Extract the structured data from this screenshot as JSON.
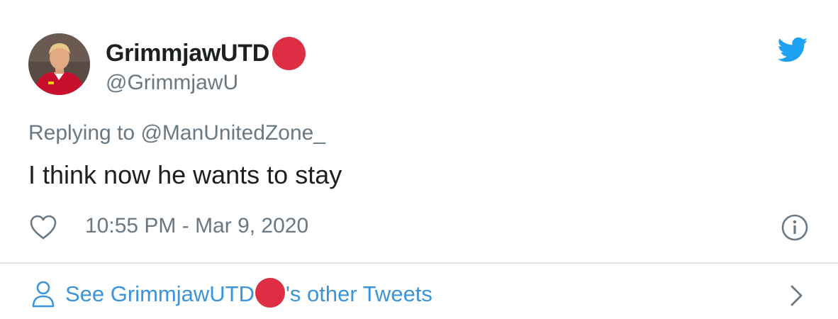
{
  "author": {
    "display_name": "GrimmjawUTD",
    "handle": "@GrimmjawU",
    "emoji": "red-circle",
    "avatar": "footballer-in-red-kit"
  },
  "reply": {
    "prefix": "Replying to ",
    "handle": "@ManUnitedZone_"
  },
  "tweet": {
    "text": "I think now he wants to stay",
    "timestamp": "10:55 PM - Mar 9, 2020"
  },
  "footer": {
    "prefix": "See GrimmjawUTD",
    "suffix": "'s other Tweets"
  },
  "icons": {
    "brand": "twitter-bird-icon",
    "like": "heart-icon",
    "info": "info-icon",
    "profile": "person-icon",
    "more": "chevron-right-icon"
  },
  "colors": {
    "twitter_blue": "#1da1f2",
    "link_blue": "#3b94d9",
    "text_primary": "#1c2022",
    "text_secondary": "#697882",
    "red_circle": "#dd2e44",
    "divider": "#e1e8ed"
  }
}
